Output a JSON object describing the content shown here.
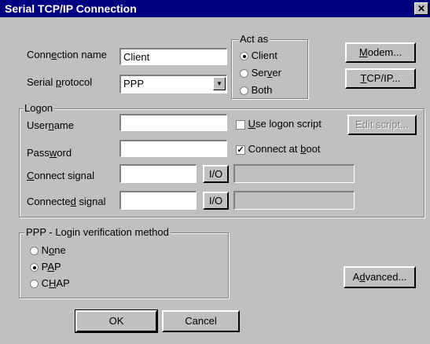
{
  "window": {
    "title": "Serial TCP/IP Connection",
    "close_glyph": "✕"
  },
  "connection_name": {
    "label_pre": "Conn",
    "label_key": "e",
    "label_post": "ction name",
    "value": "Client"
  },
  "serial_protocol": {
    "label_pre": "Serial ",
    "label_key": "p",
    "label_post": "rotocol",
    "value": "PPP"
  },
  "act_as": {
    "legend": "Act as",
    "options": [
      {
        "label": "Client",
        "selected": true
      },
      {
        "pre": "Ser",
        "key": "v",
        "post": "er",
        "selected": false
      },
      {
        "label": "Both",
        "selected": false
      }
    ]
  },
  "buttons": {
    "modem": {
      "key": "M",
      "post": "odem..."
    },
    "tcpip": {
      "key": "T",
      "post": "CP/IP..."
    },
    "edit_script": "Edit script...",
    "io": "I/O",
    "advanced": {
      "pre": "A",
      "key": "d",
      "post": "vanced..."
    },
    "ok": "OK",
    "cancel": "Cancel"
  },
  "logon": {
    "legend": "Logon",
    "username": {
      "pre": "User",
      "key": "n",
      "post": "ame",
      "value": ""
    },
    "password": {
      "pre": "Pass",
      "key": "w",
      "post": "ord",
      "value": ""
    },
    "connect_signal": {
      "key": "C",
      "post": "onnect signal",
      "value": "",
      "extra": ""
    },
    "connected_signal": {
      "pre": "Connecte",
      "key": "d",
      "post": " signal",
      "value": "",
      "extra": ""
    },
    "use_logon_script": {
      "key": "U",
      "post": "se logon script",
      "checked": false
    },
    "connect_at_boot": {
      "pre": "Connect at ",
      "key": "b",
      "post": "oot",
      "checked": true
    }
  },
  "ppp_login": {
    "legend": "PPP - Login verification method",
    "options": [
      {
        "pre": "N",
        "key": "o",
        "post": "ne",
        "selected": false
      },
      {
        "pre": "P",
        "key": "A",
        "post": "P",
        "selected": true
      },
      {
        "pre": "C",
        "key": "H",
        "post": "AP",
        "selected": false
      }
    ]
  },
  "colors": {
    "titlebar": "#000080",
    "face": "#c0c0c0",
    "field": "#ffffff"
  },
  "icons": {
    "dropdown": "triangle-down-icon",
    "check": "checkmark-icon"
  }
}
